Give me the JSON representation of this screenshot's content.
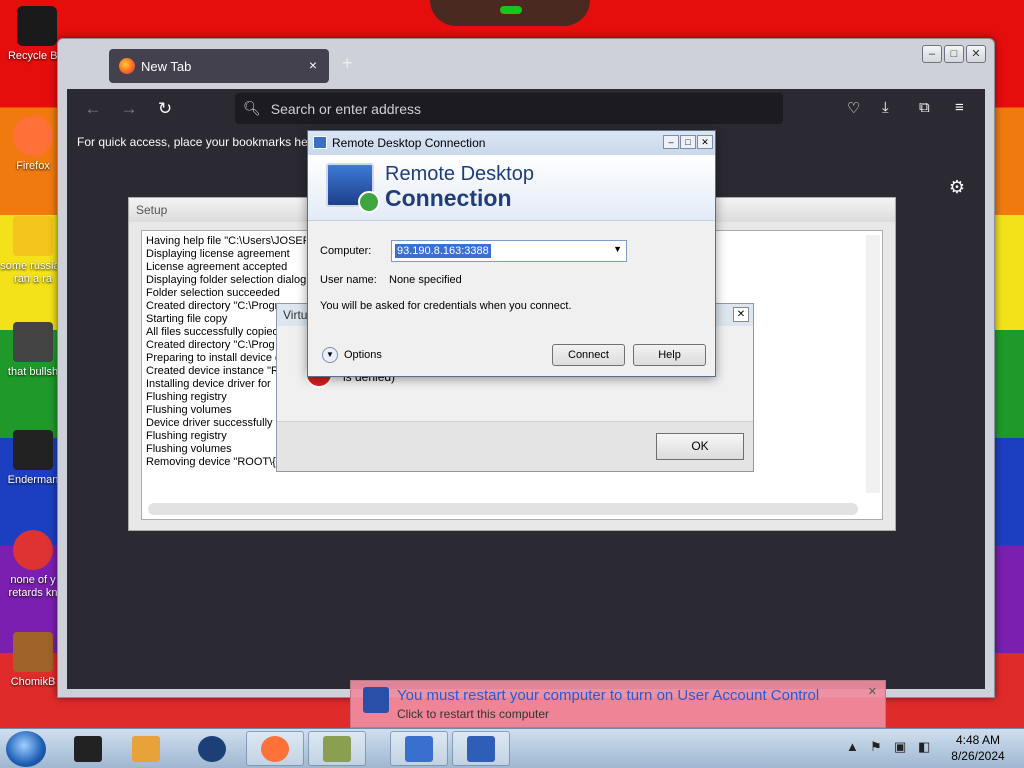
{
  "desktop": {
    "icons": [
      {
        "label": "Recycle Bin",
        "color": "#222222"
      },
      {
        "label": "Firefox",
        "color": "#ff7139"
      },
      {
        "label": "some russian ran a ra",
        "color": "#f4c51c"
      },
      {
        "label": "that bullsh",
        "color": "#444444"
      },
      {
        "label": "Enderman",
        "color": "#222222"
      },
      {
        "label": "none of y retards kn",
        "color": "#d33"
      },
      {
        "label": "ChomikB",
        "color": "#a0632a"
      }
    ]
  },
  "browser": {
    "tab_title": "New Tab",
    "tab_close": "×",
    "new_tab": "+",
    "address_placeholder": "Search or enter address",
    "bookmarks_hint": "For quick access, place your bookmarks her"
  },
  "setup": {
    "title": "Setup",
    "log": [
      "Having help file \"C:\\Users\\JOSEPH",
      "Displaying license agreement",
      "License agreement accepted",
      "Displaying folder selection dialog",
      "Folder selection succeeded",
      "Created directory \"C:\\Progr",
      "Starting file copy",
      "All files successfully copied",
      "Created directory \"C:\\Prog",
      "Preparing to install device d",
      "Created device instance \"R",
      "Installing device driver for",
      "Flushing registry",
      "Flushing volumes",
      "Device driver successfully i",
      "Flushing registry",
      "Flushing volumes",
      "Removing device \"ROOT\\{8"
    ]
  },
  "virtual_dialog": {
    "title": "Virtu",
    "message": "is denied)",
    "ok_label": "OK"
  },
  "rdc": {
    "title": "Remote Desktop Connection",
    "banner_line1": "Remote Desktop",
    "banner_line2": "Connection",
    "computer_label": "Computer:",
    "computer_value": "93.190.8.163:3388",
    "username_label": "User name:",
    "username_value": "None specified",
    "info": "You will be asked for credentials when you connect.",
    "options_label": "Options",
    "connect_label": "Connect",
    "help_label": "Help"
  },
  "notification": {
    "title": "You must restart your computer to turn on User Account Control",
    "subtitle": "Click to restart this computer"
  },
  "taskbar": {
    "time": "4:48 AM",
    "date": "8/26/2024",
    "items": [
      {
        "name": "terminal",
        "color": "#222222"
      },
      {
        "name": "media-player",
        "color": "#e8a23a"
      },
      {
        "name": "browser-globe",
        "color": "#1c3f78"
      },
      {
        "name": "firefox",
        "color": "#ff7139"
      },
      {
        "name": "box",
        "color": "#8aa050"
      },
      {
        "name": "network",
        "color": "#3a6fd0"
      },
      {
        "name": "remote-desktop",
        "color": "#2e5eb8"
      }
    ]
  }
}
